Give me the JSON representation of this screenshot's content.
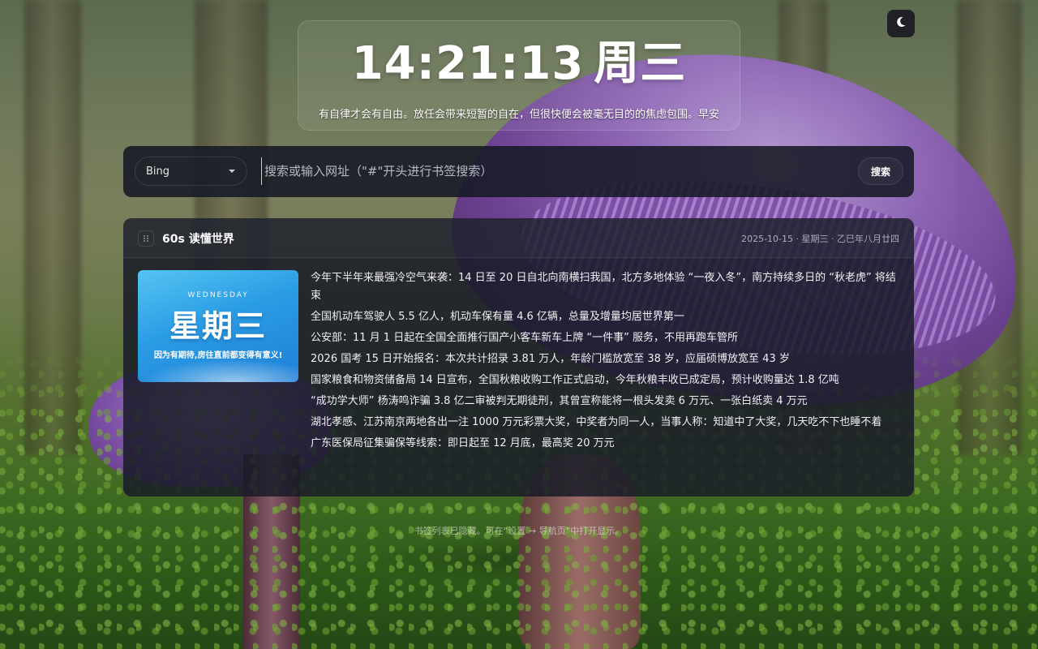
{
  "theme_toggle": {
    "icon": "moon-icon"
  },
  "clock": {
    "time": "14:21:13",
    "weekday": "周三",
    "quote": "有自律才会有自由。放任会带来短暂的自在，但很快便会被毫无目的的焦虑包围。早安"
  },
  "search": {
    "engine": "Bing",
    "placeholder": "搜索或输入网址（\"#\"开头进行书签搜索）",
    "value": "",
    "button_label": "搜索"
  },
  "news": {
    "title": "60s 读懂世界",
    "date": "2025-10-15 · 星期三 · 乙巳年八月廿四",
    "image": {
      "weekday_en": "WEDNESDAY",
      "weekday_cn": "星期三",
      "slogan": "因为有期待,房往直前都变得有意义!"
    },
    "items": [
      "今年下半年来最强冷空气来袭：14 日至 20 日自北向南横扫我国，北方多地体验 “一夜入冬”，南方持续多日的 “秋老虎” 将结束",
      "全国机动车驾驶人 5.5 亿人，机动车保有量 4.6 亿辆，总量及增量均居世界第一",
      "公安部：11 月 1 日起在全国全面推行国产小客车新车上牌 “一件事” 服务，不用再跑车管所",
      "2026 国考 15 日开始报名：本次共计招录 3.81 万人，年龄门槛放宽至 38 岁，应届硕博放宽至 43 岁",
      "国家粮食和物资储备局 14 日宣布，全国秋粮收购工作正式启动，今年秋粮丰收已成定局，预计收购量达 1.8 亿吨",
      "“成功学大师” 杨涛鸣诈骗 3.8 亿二审被判无期徒刑，其曾宣称能将一根头发卖 6 万元、一张白纸卖 4 万元",
      "湖北孝感、江苏南京两地各出一注 1000 万元彩票大奖，中奖者为同一人，当事人称：知道中了大奖，几天吃不下也睡不着",
      "广东医保局征集骗保等线索：即日起至 12 月底，最高奖 20 万元"
    ]
  },
  "footer": {
    "hint": "书签列表已隐藏。可在“设置 → 导航页”中打开显示。"
  }
}
